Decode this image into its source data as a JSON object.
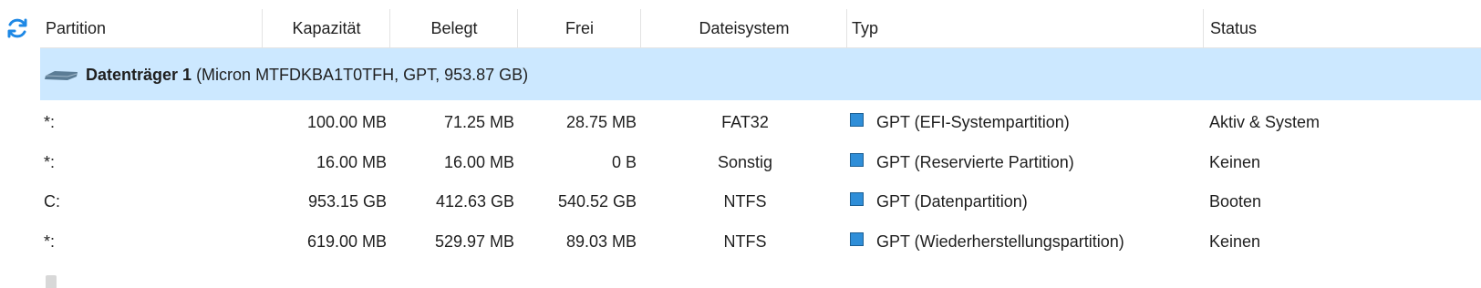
{
  "header": {
    "refresh_icon": "refresh-icon",
    "columns": [
      "Partition",
      "Kapazität",
      "Belegt",
      "Frei",
      "Dateisystem",
      "Typ",
      "Status"
    ]
  },
  "disk": {
    "name": "Datenträger 1",
    "details": "(Micron MTFDKBA1T0TFH, GPT, 953.87 GB)",
    "icon": "disk-icon",
    "selected_color": "#cce8ff"
  },
  "partitions": [
    {
      "partition": "*:",
      "capacity": "100.00 MB",
      "used": "71.25 MB",
      "free": "28.75 MB",
      "filesystem": "FAT32",
      "type": "GPT (EFI-Systempartition)",
      "status": "Aktiv & System"
    },
    {
      "partition": "*:",
      "capacity": "16.00 MB",
      "used": "16.00 MB",
      "free": "0 B",
      "filesystem": "Sonstig",
      "type": "GPT (Reservierte Partition)",
      "status": "Keinen"
    },
    {
      "partition": "C:",
      "capacity": "953.15 GB",
      "used": "412.63 GB",
      "free": "540.52 GB",
      "filesystem": "NTFS",
      "type": "GPT (Datenpartition)",
      "status": "Booten"
    },
    {
      "partition": "*:",
      "capacity": "619.00 MB",
      "used": "529.97 MB",
      "free": "89.03 MB",
      "filesystem": "NTFS",
      "type": "GPT (Wiederherstellungspartition)",
      "status": "Keinen"
    }
  ],
  "colors": {
    "accent": "#2f8ed8",
    "header_border": "#e3e3e3"
  }
}
